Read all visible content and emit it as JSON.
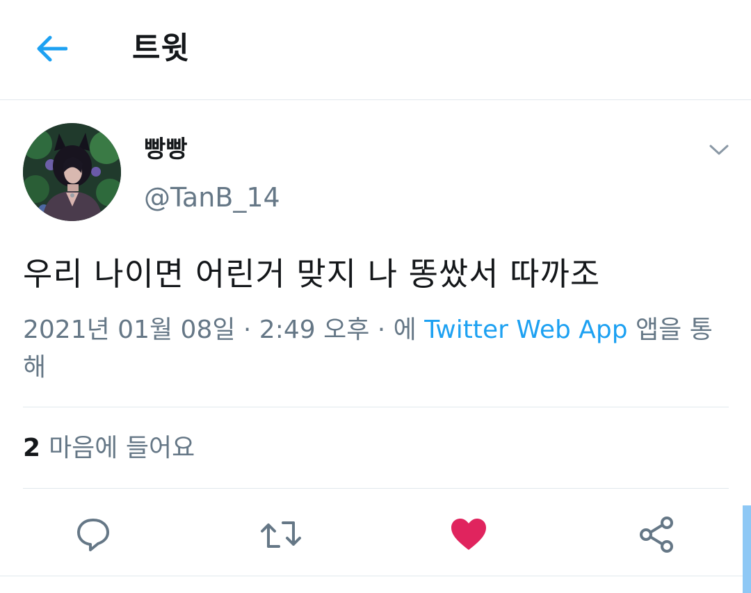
{
  "header": {
    "title": "트윗",
    "back_icon": "arrow-left-icon"
  },
  "tweet": {
    "display_name": "빵빵",
    "handle": "@TanB_14",
    "text": "우리 나이면 어린거 맞지 나 똥쌌서 따까조",
    "meta_prefix": "2021년 01월 08일 · 2:49 오후 · 에 ",
    "source": "Twitter Web App",
    "meta_suffix": " 앱을 통해",
    "likes_count": "2",
    "likes_label": "마음에 들어요"
  },
  "actions": {
    "reply_icon": "reply-icon",
    "retweet_icon": "retweet-icon",
    "like_icon": "heart-icon",
    "share_icon": "share-icon"
  },
  "colors": {
    "accent": "#1da1f2",
    "like": "#e0245e",
    "secondary": "#657786",
    "divider": "#e1e8ed"
  }
}
